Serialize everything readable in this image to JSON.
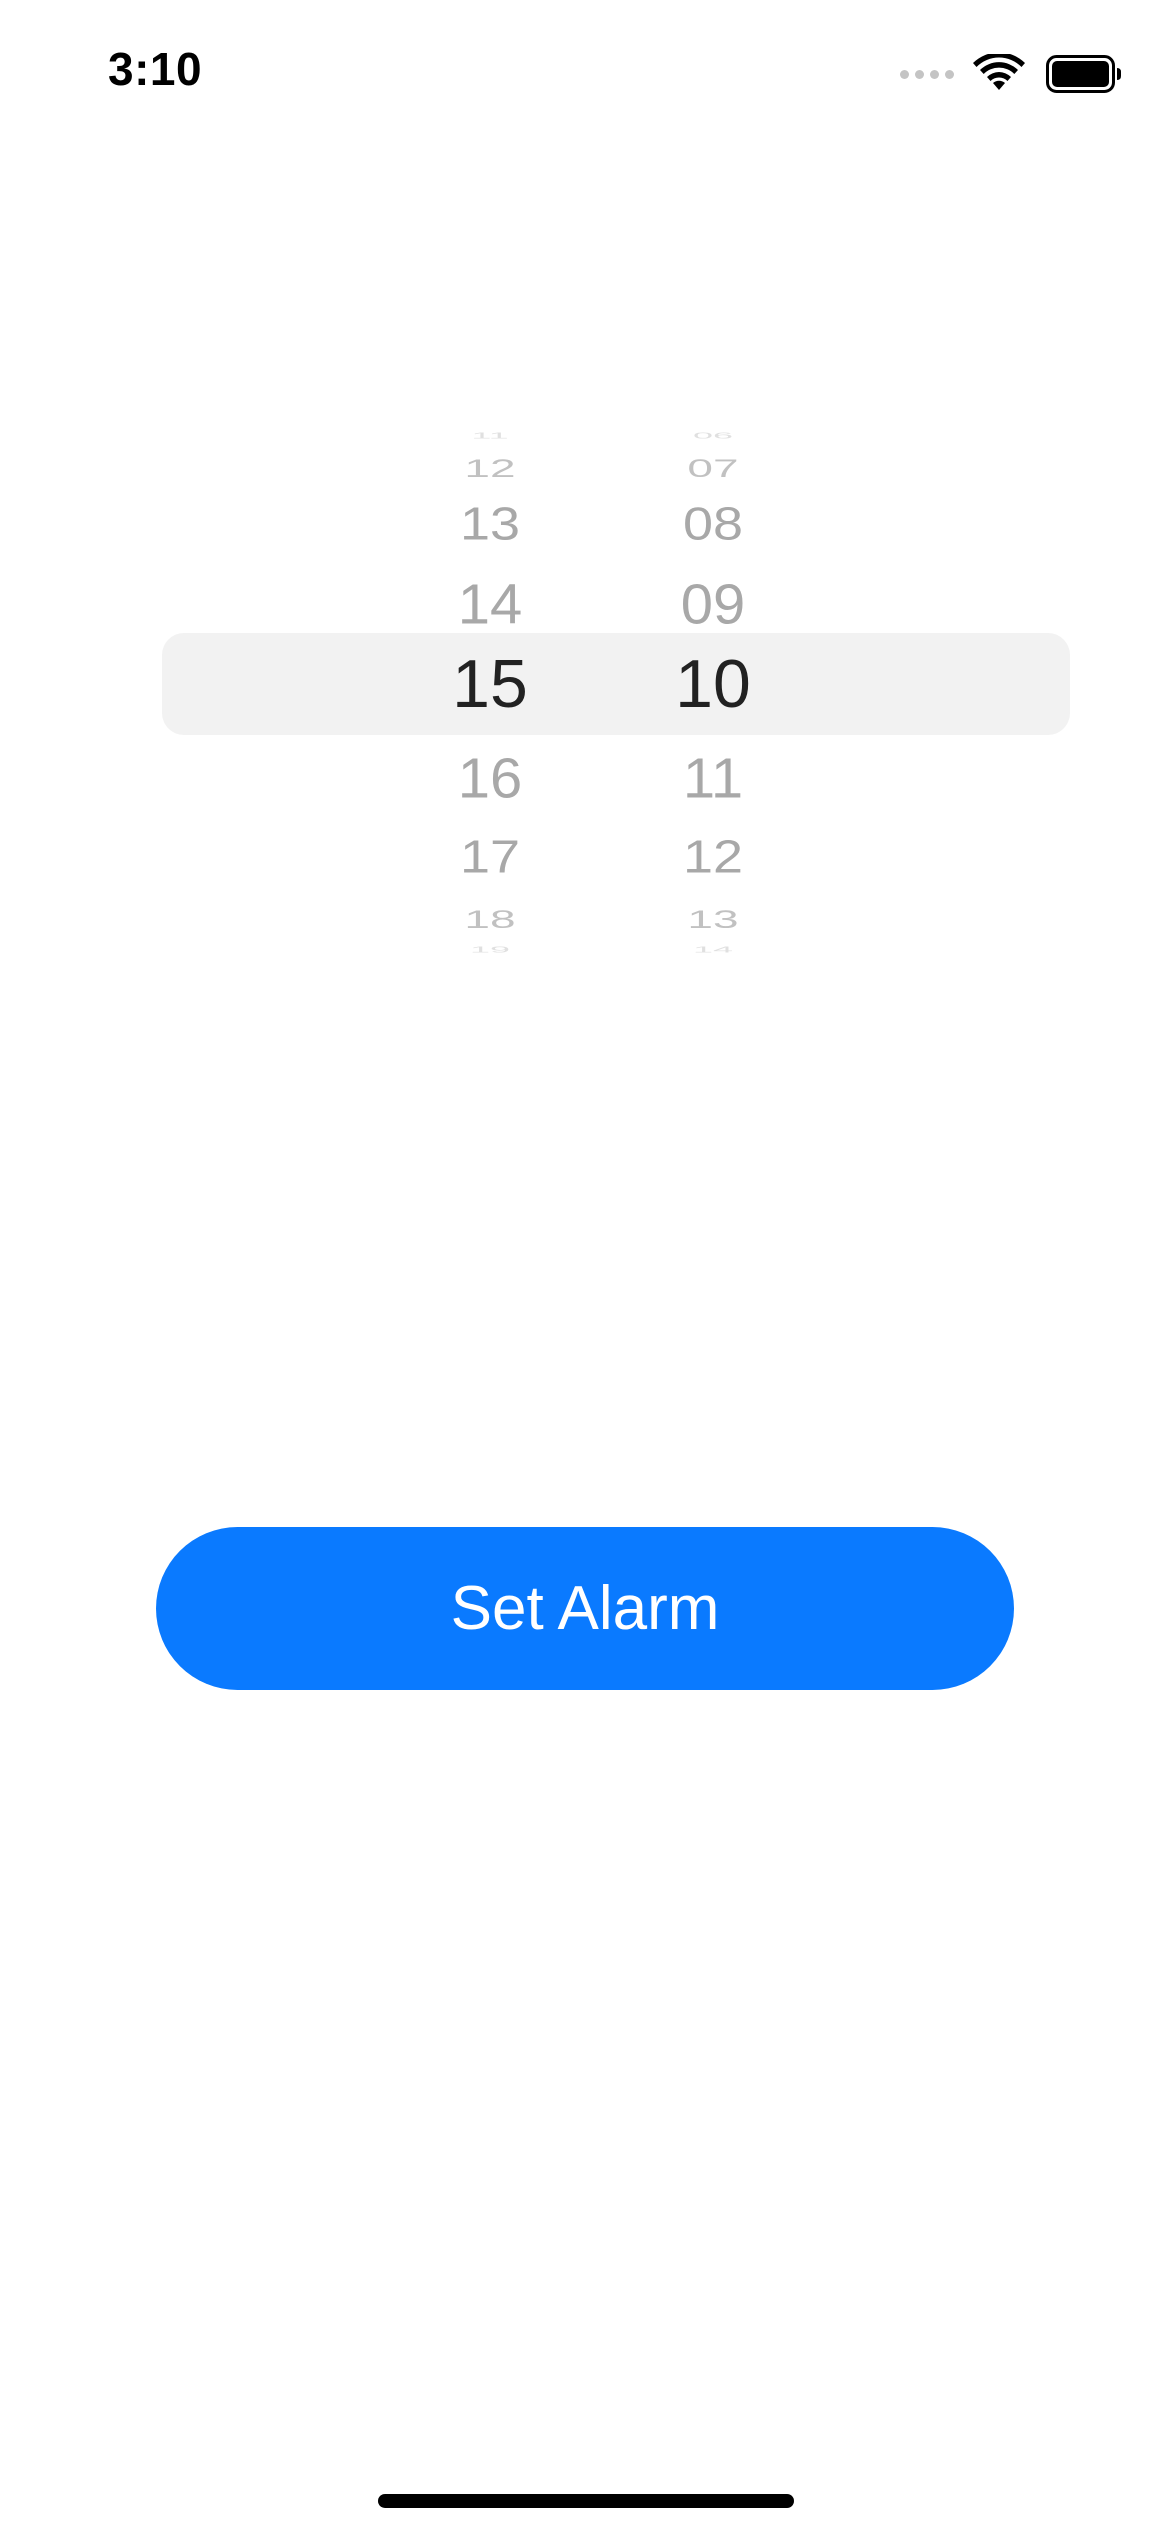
{
  "status_bar": {
    "time": "3:10",
    "icons": [
      "signal-icon",
      "wifi-icon",
      "battery-icon"
    ]
  },
  "time_picker": {
    "hours": {
      "items": [
        "11",
        "12",
        "13",
        "14",
        "15",
        "16",
        "17",
        "18",
        "19"
      ],
      "selected": "15"
    },
    "minutes": {
      "items": [
        "06",
        "07",
        "08",
        "09",
        "10",
        "11",
        "12",
        "13",
        "14"
      ],
      "selected": "10"
    }
  },
  "set_alarm_button": {
    "label": "Set Alarm"
  },
  "colors": {
    "accent": "#0a7aff",
    "selection_band": "#f2f2f2",
    "picker_text": "#a8a8a8",
    "picker_selected_text": "#222222"
  }
}
